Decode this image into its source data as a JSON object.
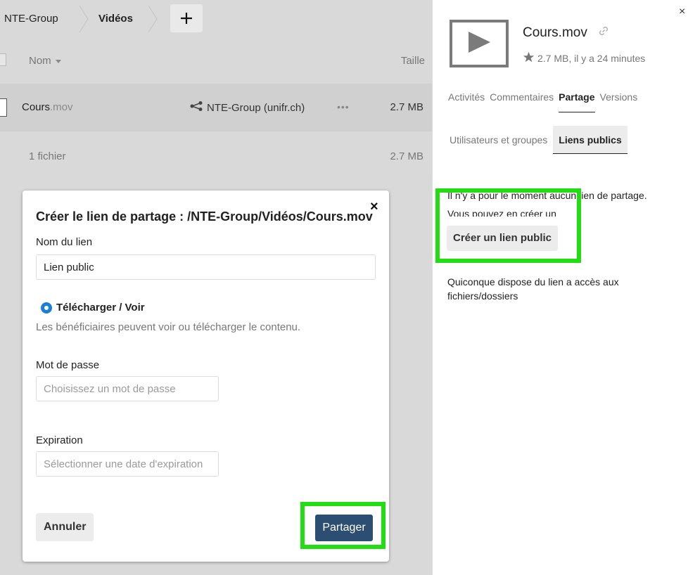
{
  "breadcrumb": {
    "group": "NTE-Group",
    "folder": "Vidéos"
  },
  "file_list": {
    "columns": {
      "name": "Nom",
      "size": "Taille"
    },
    "file": {
      "base": "Cours",
      "ext": ".mov",
      "shared_with": "NTE-Group (unifr.ch)",
      "more": "•••",
      "size": "2.7 MB"
    },
    "summary": {
      "label": "1 fichier",
      "size": "2.7 MB"
    }
  },
  "sidebar": {
    "close": "×",
    "file_title": "Cours.mov",
    "meta": "2.7 MB, il y a 24 minutes",
    "tabs": [
      "Activités",
      "Commentaires",
      "Partage",
      "Versions"
    ],
    "active_tab": "Partage",
    "subtabs": [
      "Utilisateurs et groupes",
      "Liens publics"
    ],
    "active_subtab": "Liens publics",
    "no_links_line1": "Il n'y a pour le moment aucun lien de partage.",
    "no_links_line2": "Vous pouvez en créer un",
    "create_public_label": "Créer un lien public",
    "public_note": "Quiconque dispose du lien a accès aux fichiers/dossiers"
  },
  "modal": {
    "close": "×",
    "title": "Créer le lien de partage : /NTE-Group/Vidéos/Cours.mov",
    "link_name_label": "Nom du lien",
    "link_name_value": "Lien public",
    "option_label": "Télécharger / Voir",
    "option_desc": "Les bénéficiaires peuvent voir ou télécharger le contenu.",
    "password_label": "Mot de passe",
    "password_placeholder": "Choisissez un mot de passe",
    "expiration_label": "Expiration",
    "expiration_placeholder": "Sélectionner une date d'expiration",
    "cancel_label": "Annuler",
    "share_label": "Partager"
  },
  "colors": {
    "highlight": "#22dd11",
    "primary_button": "#2c4e73",
    "radio_active": "#1a7fd6"
  }
}
